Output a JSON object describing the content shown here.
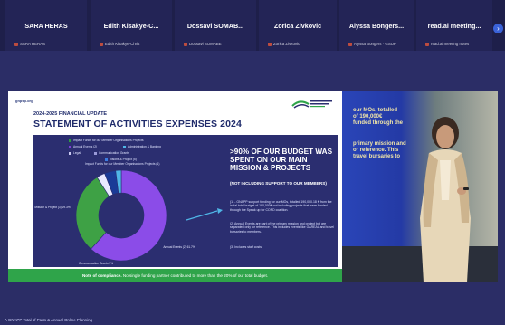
{
  "participants": [
    {
      "name": "SARA HERAS",
      "label": "SARA HERAS"
    },
    {
      "name": "Edith  Kisakye-C...",
      "label": "Edith Kisakye-Chris"
    },
    {
      "name": "Dossavi  SOMAB...",
      "label": "Dossavi SOMABE"
    },
    {
      "name": "Zorica Zivkovic",
      "label": "Zorica Zivkovic"
    },
    {
      "name": "Alyssa  Bongers...",
      "label": "Alyssa Bongers · GSUP"
    },
    {
      "name": "read.ai  meeting...",
      "label": "read.ai meeting notes"
    }
  ],
  "next_icon": "chevron-right-icon",
  "slide": {
    "url": "gnpsp.org",
    "update": "2024-2025 FINANCIAL UPDATE",
    "title": "STATEMENT OF ACTIVITIES EXPENSES 2024",
    "legend": [
      {
        "label": "Impact Funds for our Member Organisations Projects",
        "color": "#2f9e3f"
      },
      {
        "label": "Annual Events (2)",
        "color": "#7e3fd6"
      },
      {
        "label": "Administration & Banking",
        "color": "#4fb5e6"
      },
      {
        "label": "Legal",
        "color": "#c8c8f0"
      },
      {
        "label": "Communication Grants",
        "color": "#9a9ad8"
      },
      {
        "label": "Visions & Project (5)",
        "color": "#3c7be0"
      }
    ],
    "chart_caption": "Impact Funds for our Member Organisations Projects (1)",
    "headline": ">90% OF OUR BUDGET WAS SPENT ON OUR MAIN MISSION & PROJECTS",
    "note": "(NOT INCLUDING SUPPORT TO OUR MEMBERS)",
    "paragraphs": [
      "(1) - GNAPP support funding for our MOs, totalled 190,000.18 € from the initial total budget of 190,000€ not including projects that were funded through the Speak up for COPD coalition.",
      "(2) Annual Events are part of the primary mission and project but are separated only for reference. This includes events like GAREAL and travel bursaries to members.",
      "(3) Includes staff costs"
    ],
    "footnote_bold": "Note of compliance.",
    "footnote_rest": " No single funding partner contributed to more than the 20% of our total budget."
  },
  "chart_data": {
    "type": "pie",
    "title": "Impact Funds for our Member Organisations Projects (1)",
    "categories": [
      "Annual Events (2)",
      "Visions & Project (3)",
      "Communication Grants",
      "Administration & Banking",
      "Legal"
    ],
    "values": [
      61.7,
      29.3,
      3,
      4,
      2
    ],
    "value_labels": [
      "Annual Events (2) 61.7%",
      "Mission & Project (3) 29.3%",
      "Communication Grants 3%"
    ],
    "colors": [
      "#8b4ce8",
      "#3ea145",
      "#e9e9ff",
      "#1a3a97",
      "#4fb5e6"
    ]
  },
  "video": {
    "wall_lines": [
      "our MOs, totalled",
      "of 190,000€",
      "funded through the",
      "",
      "primary mission and",
      "or reference. This",
      "travel bursaries to"
    ]
  },
  "caption": "A  GNAPP  Total  of  Parts  &  Annual  Online  Planning"
}
